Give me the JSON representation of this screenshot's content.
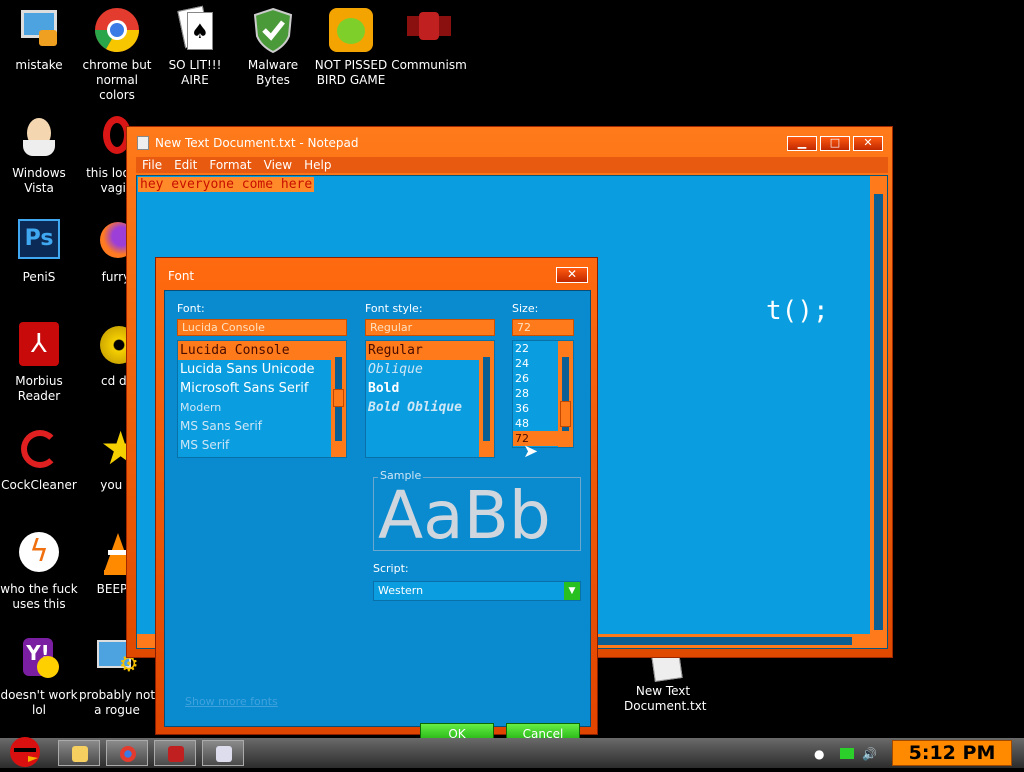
{
  "desktop": {
    "icons": [
      {
        "label": "mistake"
      },
      {
        "label": "chrome but normal colors"
      },
      {
        "label": "SO LIT!!! AIRE"
      },
      {
        "label": "Malware Bytes"
      },
      {
        "label": "NOT PISSED BIRD GAME"
      },
      {
        "label": "Communism"
      },
      {
        "label": "Windows Vista"
      },
      {
        "label": "this look a vagin"
      },
      {
        "label": "PeniS"
      },
      {
        "label": "furryf"
      },
      {
        "label": "Morbius Reader"
      },
      {
        "label": "cd dri"
      },
      {
        "label": "CockCleaner"
      },
      {
        "label": "you tr"
      },
      {
        "label": "who the fuck uses this"
      },
      {
        "label": "BEEP B"
      },
      {
        "label": "doesn't work lol"
      },
      {
        "label": "probably not a rogue"
      },
      {
        "label": "New Text Document.txt"
      }
    ]
  },
  "notepad": {
    "title": "New Text Document.txt - Notepad",
    "menu": [
      "File",
      "Edit",
      "Format",
      "View",
      "Help"
    ],
    "text": "hey everyone come here",
    "background_code": "t();"
  },
  "font_dialog": {
    "title": "Font",
    "font_label": "Font:",
    "font_value": "Lucida Console",
    "fonts": [
      "Lucida Console",
      "Lucida Sans Unicode",
      "Microsoft Sans Serif",
      "Modern",
      "MS Sans Serif",
      "MS Serif"
    ],
    "style_label": "Font style:",
    "style_value": "Regular",
    "styles": [
      "Regular",
      "Oblique",
      "Bold",
      "Bold Oblique"
    ],
    "size_label": "Size:",
    "size_value": "72",
    "sizes": [
      "22",
      "24",
      "26",
      "28",
      "36",
      "48",
      "72"
    ],
    "sample_label": "Sample",
    "sample_text": "AaBb",
    "script_label": "Script:",
    "script_value": "Western",
    "show_more": "Show more fonts",
    "ok": "OK",
    "cancel": "Cancel"
  },
  "taskbar": {
    "clock": "5:12 PM"
  },
  "colors": {
    "window_orange": "#ff7a1a",
    "client_blue": "#0a9ee0",
    "button_green": "#27c020"
  }
}
